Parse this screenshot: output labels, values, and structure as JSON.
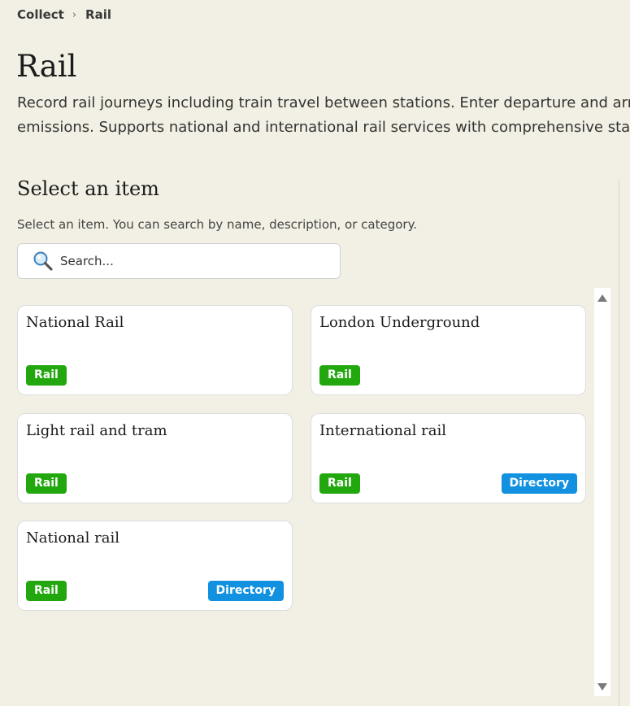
{
  "breadcrumb": {
    "items": [
      "Collect",
      "Rail"
    ],
    "separator": "›"
  },
  "page": {
    "title": "Rail",
    "description_line1": "Record rail journeys including train travel between stations. Enter departure and arrival stations to calculate",
    "description_line2": "emissions. Supports national and international rail services with comprehensive station coverage."
  },
  "selector": {
    "title": "Select an item",
    "help": "Select an item. You can search by name, description, or category.",
    "search_placeholder": "Search..."
  },
  "items": [
    {
      "title": "National Rail",
      "tags": [
        "Rail"
      ]
    },
    {
      "title": "London Underground",
      "tags": [
        "Rail"
      ]
    },
    {
      "title": "Light rail and tram",
      "tags": [
        "Rail"
      ]
    },
    {
      "title": "International rail",
      "tags": [
        "Rail",
        "Directory"
      ]
    },
    {
      "title": "National rail",
      "tags": [
        "Rail",
        "Directory"
      ]
    }
  ],
  "colors": {
    "background": "#f2f0e4",
    "rail_tag": "#22a80e",
    "directory_tag": "#1191e0"
  },
  "icons": {
    "search": "magnifying-glass-icon"
  }
}
